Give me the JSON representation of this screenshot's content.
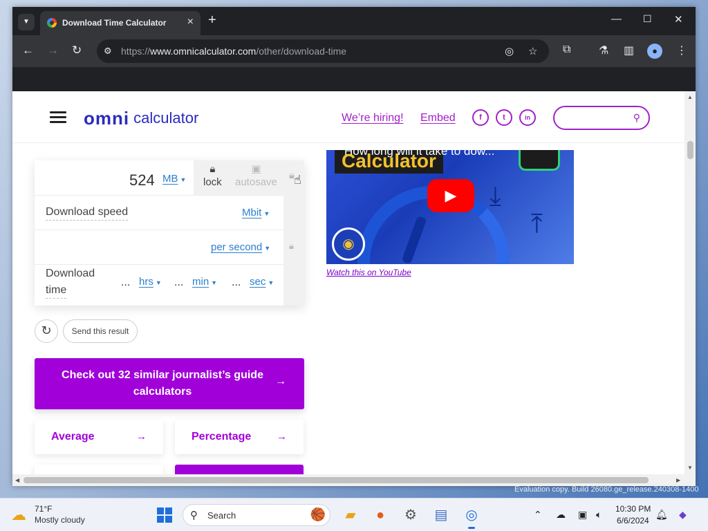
{
  "browser": {
    "tab_title": "Download Time Calculator",
    "url_scheme": "https://",
    "url_host": "www.omnicalculator.com",
    "url_path": "/other/download-time"
  },
  "site": {
    "logo_mark": "omni",
    "logo_word": "calculator",
    "hiring_link": "We’re hiring!",
    "embed_link": "Embed",
    "social": [
      "f",
      "t",
      "in"
    ]
  },
  "calculator": {
    "file_size_value": "524",
    "file_size_unit": "MB",
    "lock_label": "lock",
    "autosave_label": "autosave",
    "download_speed_label": "Download speed",
    "download_speed_unit": "Mbit",
    "per_unit": "per second",
    "download_time_label_line1": "Download",
    "download_time_label_line2": "time",
    "time_ellipsis": "...",
    "hours_unit": "hrs",
    "minutes_unit": "min",
    "seconds_unit": "sec",
    "send_result_label": "Send this result"
  },
  "promo": {
    "label": "Check out 32 similar journalist’s guide calculators"
  },
  "categories": [
    {
      "label": "Average"
    },
    {
      "label": "Percentage"
    }
  ],
  "video": {
    "title_line": "How long will it take to dow...",
    "caption": "Calculator",
    "watch_link": "Watch this on YouTube"
  },
  "watermark": "Evaluation copy. Build 26080.ge_release.240308-1400",
  "taskbar": {
    "weather_temp": "71°F",
    "weather_desc": "Mostly cloudy",
    "search_label": "Search",
    "clock_time": "10:30 PM",
    "clock_date": "6/6/2024"
  },
  "colors": {
    "brand_purple": "#a100d9",
    "link_blue": "#2a7fcf",
    "chrome_dark": "#202124"
  }
}
